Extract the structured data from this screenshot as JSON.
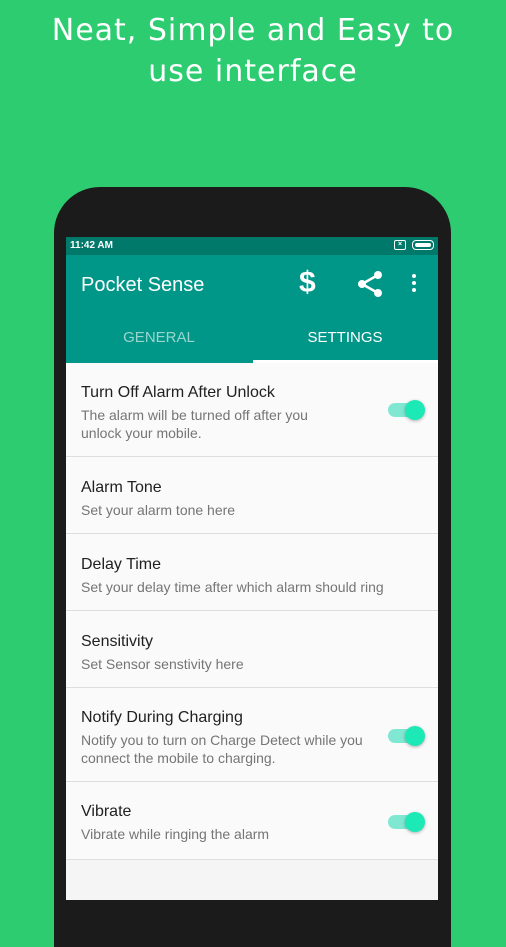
{
  "promo": {
    "line1": "Neat, Simple and Easy to",
    "line2": "use interface"
  },
  "status_bar": {
    "time": "11:42 AM"
  },
  "app_bar": {
    "title": "Pocket Sense"
  },
  "tabs": [
    {
      "label": "GENERAL",
      "active": false
    },
    {
      "label": "SETTINGS",
      "active": true
    }
  ],
  "settings": [
    {
      "title": "Turn Off Alarm After Unlock",
      "subtitle": "The alarm will be turned off after you unlock your mobile.",
      "toggle": true
    },
    {
      "title": "Alarm Tone",
      "subtitle": "Set your alarm tone here"
    },
    {
      "title": "Delay Time",
      "subtitle": "Set your delay time after which alarm should ring"
    },
    {
      "title": "Sensitivity",
      "subtitle": "Set Sensor senstivity here"
    },
    {
      "title": "Notify During Charging",
      "subtitle": "Notify you to turn on Charge Detect while you connect the mobile to charging.",
      "toggle": true
    },
    {
      "title": "Vibrate",
      "subtitle": "Vibrate while ringing the alarm",
      "toggle": true
    }
  ],
  "colors": {
    "background": "#2ecc71",
    "primary": "#009688",
    "primary_dark": "#00796b",
    "accent": "#1de9b6"
  },
  "icons": [
    "dollar-icon",
    "share-icon",
    "more-vert-icon",
    "battery-icon",
    "sim-icon"
  ]
}
